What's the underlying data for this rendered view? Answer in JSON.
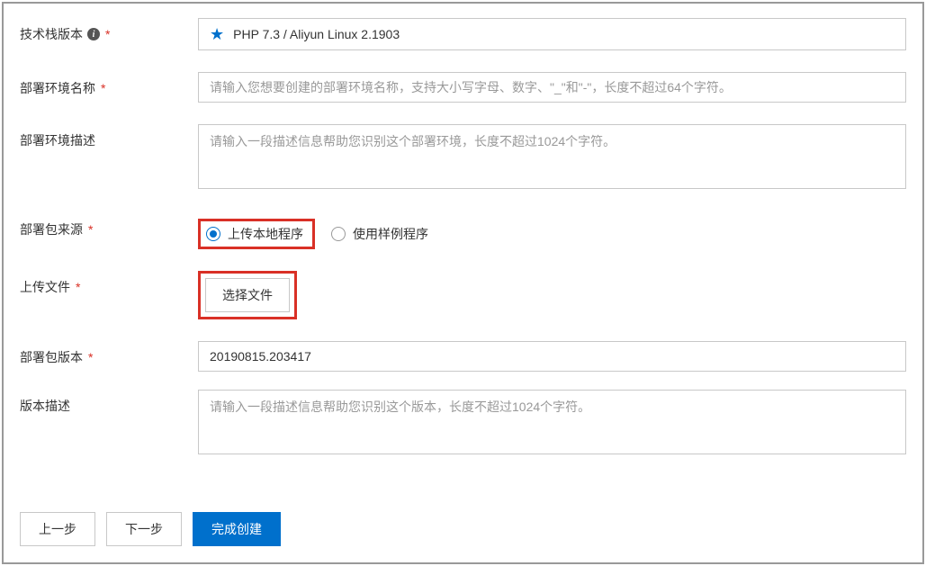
{
  "fields": {
    "stack": {
      "label": "技术栈版本",
      "value": "PHP 7.3 / Aliyun Linux 2.1903"
    },
    "envName": {
      "label": "部署环境名称",
      "placeholder": "请输入您想要创建的部署环境名称，支持大小写字母、数字、\"_\"和\"-\"，长度不超过64个字符。"
    },
    "envDesc": {
      "label": "部署环境描述",
      "placeholder": "请输入一段描述信息帮助您识别这个部署环境，长度不超过1024个字符。"
    },
    "pkgSource": {
      "label": "部署包来源",
      "options": {
        "upload": "上传本地程序",
        "sample": "使用样例程序"
      }
    },
    "uploadFile": {
      "label": "上传文件",
      "button": "选择文件"
    },
    "pkgVersion": {
      "label": "部署包版本",
      "value": "20190815.203417"
    },
    "versionDesc": {
      "label": "版本描述",
      "placeholder": "请输入一段描述信息帮助您识别这个版本，长度不超过1024个字符。"
    }
  },
  "buttons": {
    "prev": "上一步",
    "next": "下一步",
    "finish": "完成创建"
  }
}
